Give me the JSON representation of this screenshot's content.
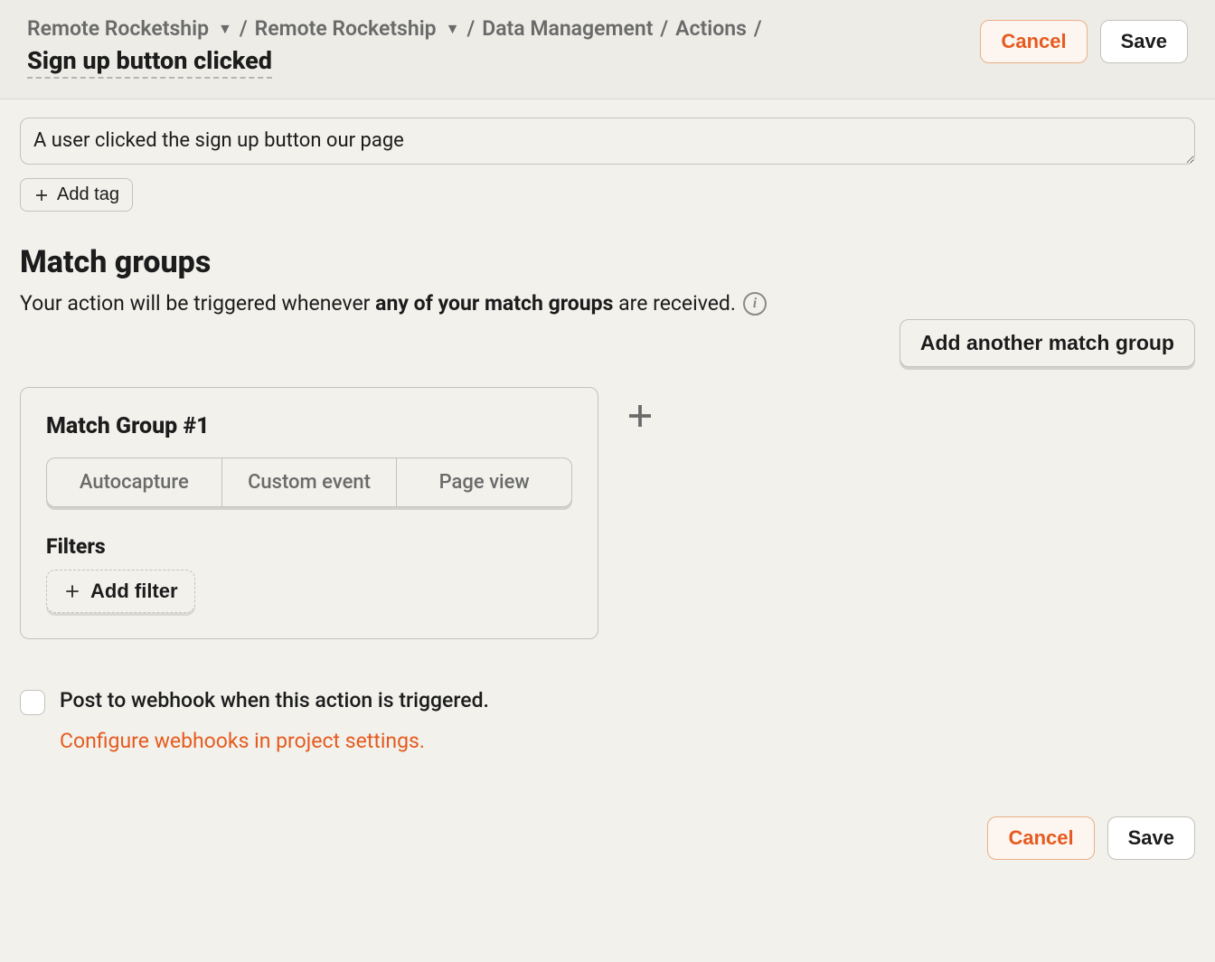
{
  "breadcrumb": {
    "items": [
      {
        "label": "Remote Rocketship",
        "dropdown": true
      },
      {
        "label": "Remote Rocketship",
        "dropdown": true
      },
      {
        "label": "Data Management",
        "dropdown": false
      },
      {
        "label": "Actions",
        "dropdown": false
      }
    ]
  },
  "page_title": "Sign up button clicked",
  "header": {
    "cancel": "Cancel",
    "save": "Save"
  },
  "description": {
    "value": "A user clicked the sign up button our page"
  },
  "add_tag_label": "Add tag",
  "match_groups": {
    "title": "Match groups",
    "subtitle_pre": "Your action will be triggered whenever ",
    "subtitle_bold": "any of your match groups",
    "subtitle_post": " are received.",
    "add_button": "Add another match group",
    "card": {
      "title": "Match Group #1",
      "tabs": [
        "Autocapture",
        "Custom event",
        "Page view"
      ],
      "filters_title": "Filters",
      "add_filter_label": "Add filter"
    }
  },
  "webhook": {
    "label": "Post to webhook when this action is triggered.",
    "link": "Configure webhooks in project settings."
  },
  "footer": {
    "cancel": "Cancel",
    "save": "Save"
  }
}
